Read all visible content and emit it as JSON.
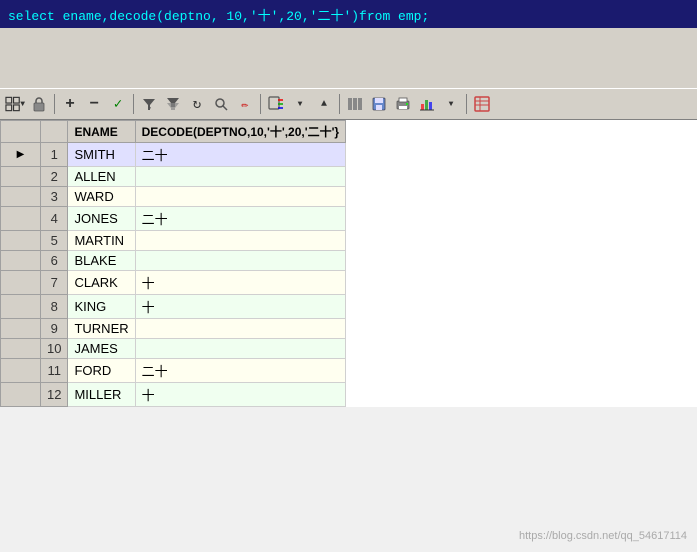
{
  "sql": {
    "query": "select ename,decode(deptno, 10,'十',20,'二十')from emp;"
  },
  "toolbar": {
    "buttons": [
      {
        "name": "grid-icon",
        "symbol": "⊞"
      },
      {
        "name": "lock-icon",
        "symbol": "🔒"
      },
      {
        "name": "add-icon",
        "symbol": "+"
      },
      {
        "name": "remove-icon",
        "symbol": "−"
      },
      {
        "name": "check-icon",
        "symbol": "✓"
      },
      {
        "name": "filter-down-icon",
        "symbol": "▼"
      },
      {
        "name": "filter-all-icon",
        "symbol": "▼▼"
      },
      {
        "name": "refresh-icon",
        "symbol": "↻"
      },
      {
        "name": "search-icon",
        "symbol": "🔍"
      },
      {
        "name": "clear-icon",
        "symbol": "✏"
      },
      {
        "name": "export-icon",
        "symbol": "↗"
      },
      {
        "name": "dropdown2-icon",
        "symbol": "▼"
      },
      {
        "name": "up-icon",
        "symbol": "▲"
      },
      {
        "name": "cols-icon",
        "symbol": "⊞"
      },
      {
        "name": "save-icon",
        "symbol": "💾"
      },
      {
        "name": "print-icon",
        "symbol": "🖨"
      },
      {
        "name": "chart-icon",
        "symbol": "📊"
      },
      {
        "name": "table-icon",
        "symbol": "⊞"
      }
    ]
  },
  "table": {
    "columns": [
      {
        "id": "indicator",
        "label": ""
      },
      {
        "id": "rownum",
        "label": ""
      },
      {
        "id": "ename",
        "label": "ENAME"
      },
      {
        "id": "decode",
        "label": "DECODE(DEPTNO,10,'十',20,'二十'}"
      }
    ],
    "rows": [
      {
        "num": 1,
        "ename": "SMITH",
        "decode": "二十",
        "active": true
      },
      {
        "num": 2,
        "ename": "ALLEN",
        "decode": ""
      },
      {
        "num": 3,
        "ename": "WARD",
        "decode": ""
      },
      {
        "num": 4,
        "ename": "JONES",
        "decode": "二十"
      },
      {
        "num": 5,
        "ename": "MARTIN",
        "decode": ""
      },
      {
        "num": 6,
        "ename": "BLAKE",
        "decode": ""
      },
      {
        "num": 7,
        "ename": "CLARK",
        "decode": "十"
      },
      {
        "num": 8,
        "ename": "KING",
        "decode": "十"
      },
      {
        "num": 9,
        "ename": "TURNER",
        "decode": ""
      },
      {
        "num": 10,
        "ename": "JAMES",
        "decode": ""
      },
      {
        "num": 11,
        "ename": "FORD",
        "decode": "二十"
      },
      {
        "num": 12,
        "ename": "MILLER",
        "decode": "十"
      }
    ]
  },
  "watermark": "https://blog.csdn.net/qq_54617114"
}
